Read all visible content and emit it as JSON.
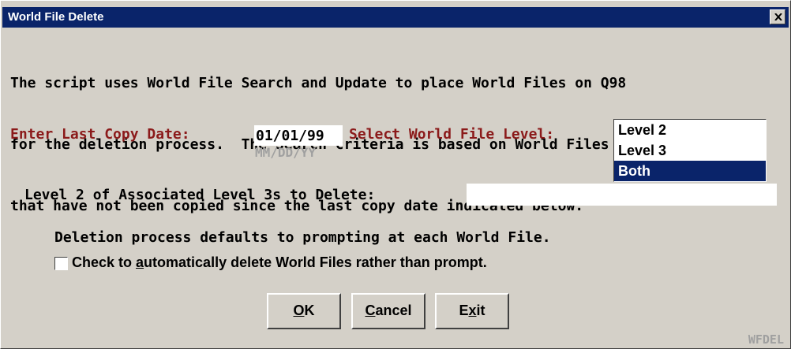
{
  "window": {
    "title": "World File Delete",
    "close_glyph": "x"
  },
  "description": {
    "line1": "The script uses World File Search and Update to place World Files on Q98",
    "line2": "for the deletion process.  The Search criteria is based on World Files",
    "line3": "that have not been copied since the last copy date indicated below."
  },
  "copy_date": {
    "label": "Enter Last Copy Date:",
    "value": "01/01/99",
    "format_hint": "MM/DD/YY"
  },
  "level_select": {
    "label": "Select World File Level:",
    "options": [
      "Level 2",
      "Level 3",
      "Both"
    ],
    "selected": "Both"
  },
  "associated": {
    "label": "Level 2 of Associated Level 3s to Delete:",
    "value": ""
  },
  "deletion_note": "Deletion process defaults to prompting at each World File.",
  "auto_delete": {
    "label_pre": "Check to ",
    "label_accel": "a",
    "label_post": "utomatically delete World Files rather than prompt.",
    "checked": false
  },
  "buttons": {
    "ok": {
      "accel": "O",
      "rest": "K"
    },
    "cancel": {
      "accel": "C",
      "rest": "ancel"
    },
    "exit": {
      "pre": "E",
      "accel": "x",
      "rest": "it"
    }
  },
  "form_code": "WFDEL",
  "colors": {
    "title_bar": "#0a246a",
    "label_red": "#8b1a1a",
    "face": "#d4d0c8",
    "hint_gray": "#a0a0a0"
  }
}
